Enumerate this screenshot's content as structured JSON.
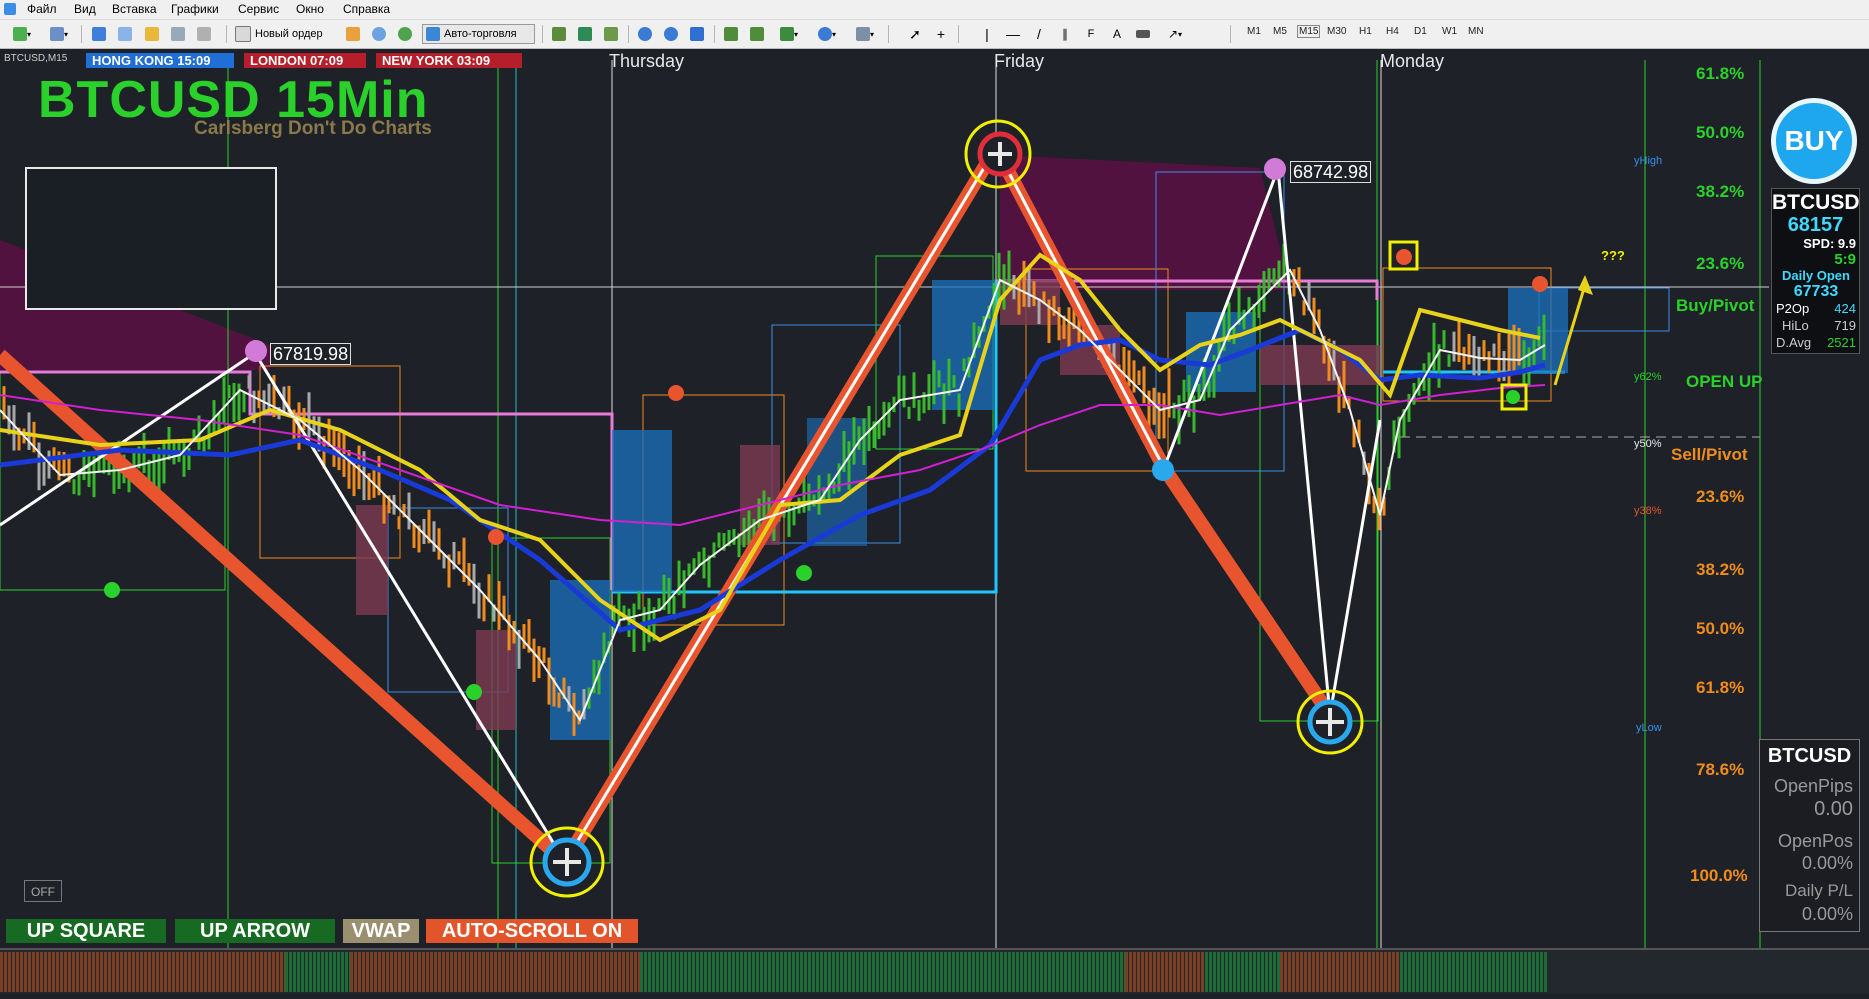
{
  "menu": [
    "Файл",
    "Вид",
    "Вставка",
    "Графики",
    "Сервис",
    "Окно",
    "Справка"
  ],
  "toolbar": {
    "new_order": "Новый ордер",
    "autotrading": "Авто-торговля",
    "timeframes": [
      "M1",
      "M5",
      "M15",
      "M30",
      "H1",
      "H4",
      "D1",
      "W1",
      "MN"
    ],
    "active_timeframe": "M15"
  },
  "chart": {
    "symbol_caption": "BTCUSD,M15",
    "title": "BTCUSD 15Min",
    "subtitle": "Carlsberg Don't Do Charts",
    "sessions": [
      {
        "label": "HONG KONG 15:09",
        "color": "#1f6fd6"
      },
      {
        "label": "LONDON  07:09",
        "color": "#b51e2a"
      },
      {
        "label": "NEW YORK  03:09",
        "color": "#b51e2a"
      }
    ],
    "days": [
      "Thursday",
      "Friday",
      "Monday"
    ],
    "price_tags": [
      "67819.98",
      "68742.98"
    ],
    "question": "???"
  },
  "fib_levels_top": [
    "61.8%",
    "50.0%",
    "38.2%",
    "23.6%"
  ],
  "fib_levels_bottom": [
    "23.6%",
    "38.2%",
    "50.0%",
    "61.8%",
    "78.6%",
    "100.0%"
  ],
  "y_labels": [
    "yHigh",
    "y62%",
    "y50%",
    "y38%",
    "yLow"
  ],
  "side_labels": {
    "buy_pivot": "Buy/Pivot",
    "open_up": "OPEN UP",
    "sell_pivot": "Sell/Pivot"
  },
  "signal": {
    "label": "BUY",
    "color": "#1ea6ee"
  },
  "info_panel": {
    "symbol": "BTCUSD",
    "price": "68157",
    "spd_label": "SPD:",
    "spd_value": "9.9",
    "ratio": "5:9",
    "daily_open_label": "Daily Open",
    "daily_open_value": "67733",
    "p2op_label": "P2Op",
    "p2op_value": "424",
    "hilo_label": "HiLo",
    "hilo_value": "719",
    "davg_label": "D.Avg",
    "davg_value": "2521"
  },
  "position_panel": {
    "symbol": "BTCUSD",
    "open_pips_label": "OpenPips",
    "open_pips_value": "0.00",
    "open_pos_label": "OpenPos",
    "open_pos_value": "0.00%",
    "daily_pl_label": "Daily P/L",
    "daily_pl_value": "0.00%"
  },
  "buttons": {
    "off": "OFF",
    "up_square": "UP SQUARE",
    "up_arrow": "UP ARROW",
    "vwap": "VWAP",
    "autoscroll": "AUTO-SCROLL ON"
  },
  "colors": {
    "bullish": "#38b82c",
    "bearish": "#f08c1c",
    "zigzag": "#e8542e",
    "ma_blue": "#1a3ad8",
    "ma_yellow": "#e8d21a",
    "ma_magenta": "#d020d0",
    "fib_up": "#2bd12b",
    "fib_down": "#f08c1c"
  }
}
